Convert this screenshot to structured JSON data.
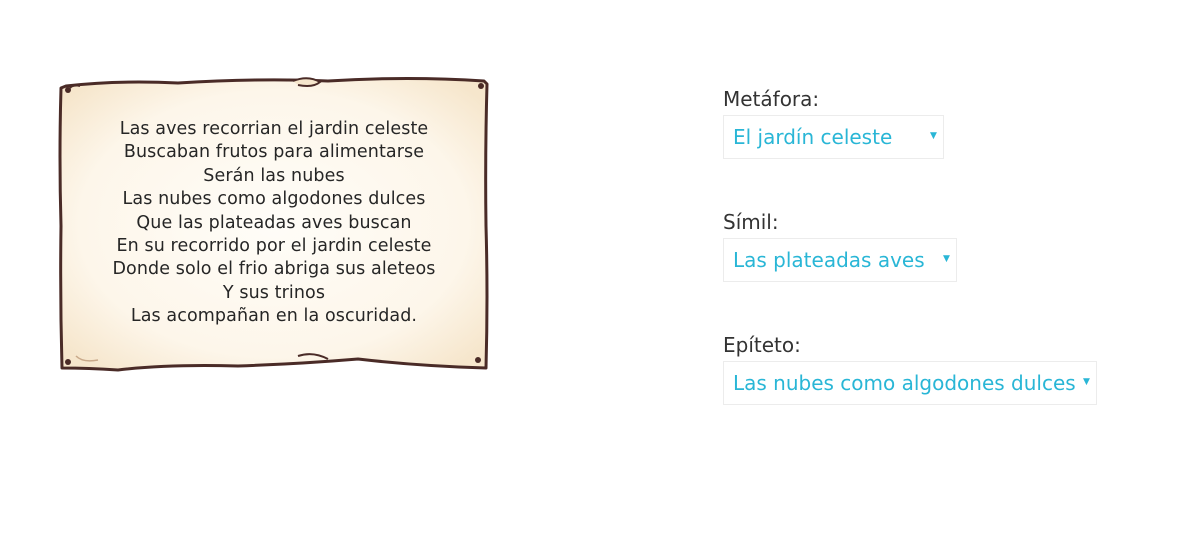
{
  "poem": {
    "lines": [
      "Las aves recorrian el jardin celeste",
      "Buscaban frutos para alimentarse",
      "Serán las nubes",
      "Las nubes como algodones dulces",
      "Que las plateadas aves buscan",
      "En su recorrido por el jardin celeste",
      "Donde solo el frio abriga sus aleteos",
      "Y sus trinos",
      "Las acompañan en la oscuridad."
    ]
  },
  "fields": [
    {
      "label": "Metáfora:",
      "selected": "El jardín celeste",
      "caret_icon": "triangle-down-icon"
    },
    {
      "label": "Símil:",
      "selected": "Las plateadas aves",
      "caret_icon": "triangle-down-icon"
    },
    {
      "label": "Epíteto:",
      "selected": "Las nubes como algodones dulces",
      "caret_icon": "triangle-down-icon"
    }
  ],
  "colors": {
    "accent": "#29b6d6",
    "label": "#333333",
    "parchment_fill": "#fdf4e6",
    "parchment_border": "#4a2b27"
  }
}
